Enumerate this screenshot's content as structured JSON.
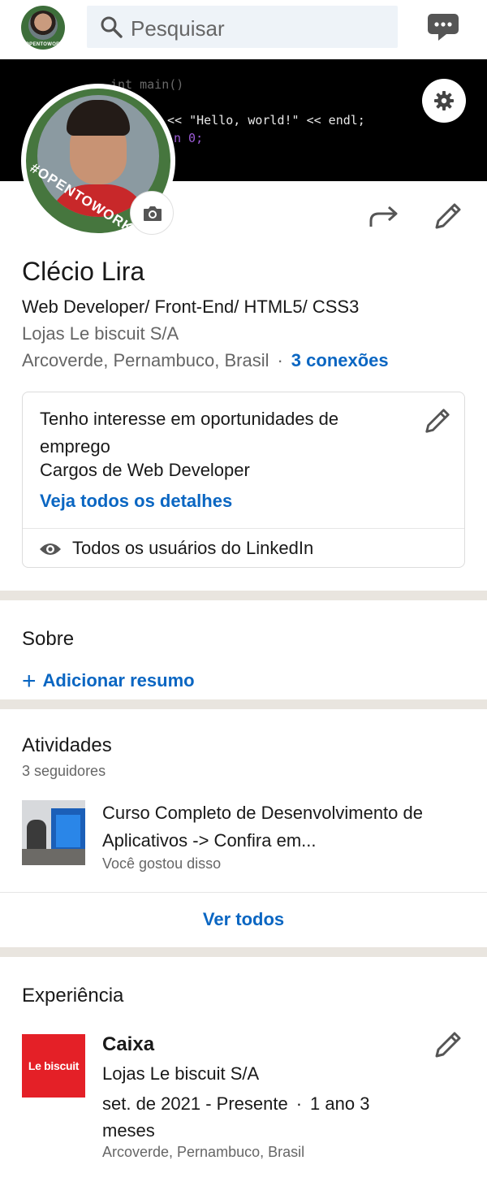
{
  "topbar": {
    "avatar_badge": "#OPENTOWORK",
    "search_placeholder": "Pesquisar",
    "search_icon": "search-icon",
    "messages_icon": "messages-icon"
  },
  "banner": {
    "code_lines": [
      "int main()",
      "<< \"Hello, world!\" << endl;",
      "n 0;"
    ]
  },
  "profile": {
    "badge": "#OPENTOWORK",
    "name": "Clécio Lira",
    "headline": "Web Developer/ Front-End/ HTML5/ CSS3",
    "company": "Lojas Le biscuit S/A",
    "location": "Arcoverde, Pernambuco, Brasil",
    "separator": "·",
    "connections": "3 conexões"
  },
  "open_to_work": {
    "title": "Tenho interesse em oportunidades de emprego",
    "roles": "Cargos de Web Developer",
    "details_link": "Veja todos os detalhes",
    "visibility": "Todos os usuários do LinkedIn"
  },
  "about": {
    "title": "Sobre",
    "add_summary": "Adicionar resumo"
  },
  "activity": {
    "title": "Atividades",
    "followers": "3 seguidores",
    "post_title": "Curso Completo de Desenvolvimento de Aplicativos -> Confira em...",
    "post_meta": "Você gostou disso",
    "see_all": "Ver todos"
  },
  "experience": {
    "title": "Experiência",
    "logo_text": "Le biscuit",
    "role": "Caixa",
    "company": "Lojas Le biscuit S/A",
    "dates": "set. de 2021 - Presente",
    "separator": "·",
    "duration": "1 ano 3 meses",
    "location": "Arcoverde, Pernambuco, Brasil"
  },
  "colors": {
    "accent": "#0a66c2",
    "otw_green": "#46763e",
    "brand_red": "#e42027",
    "divider": "#e9e5df"
  }
}
